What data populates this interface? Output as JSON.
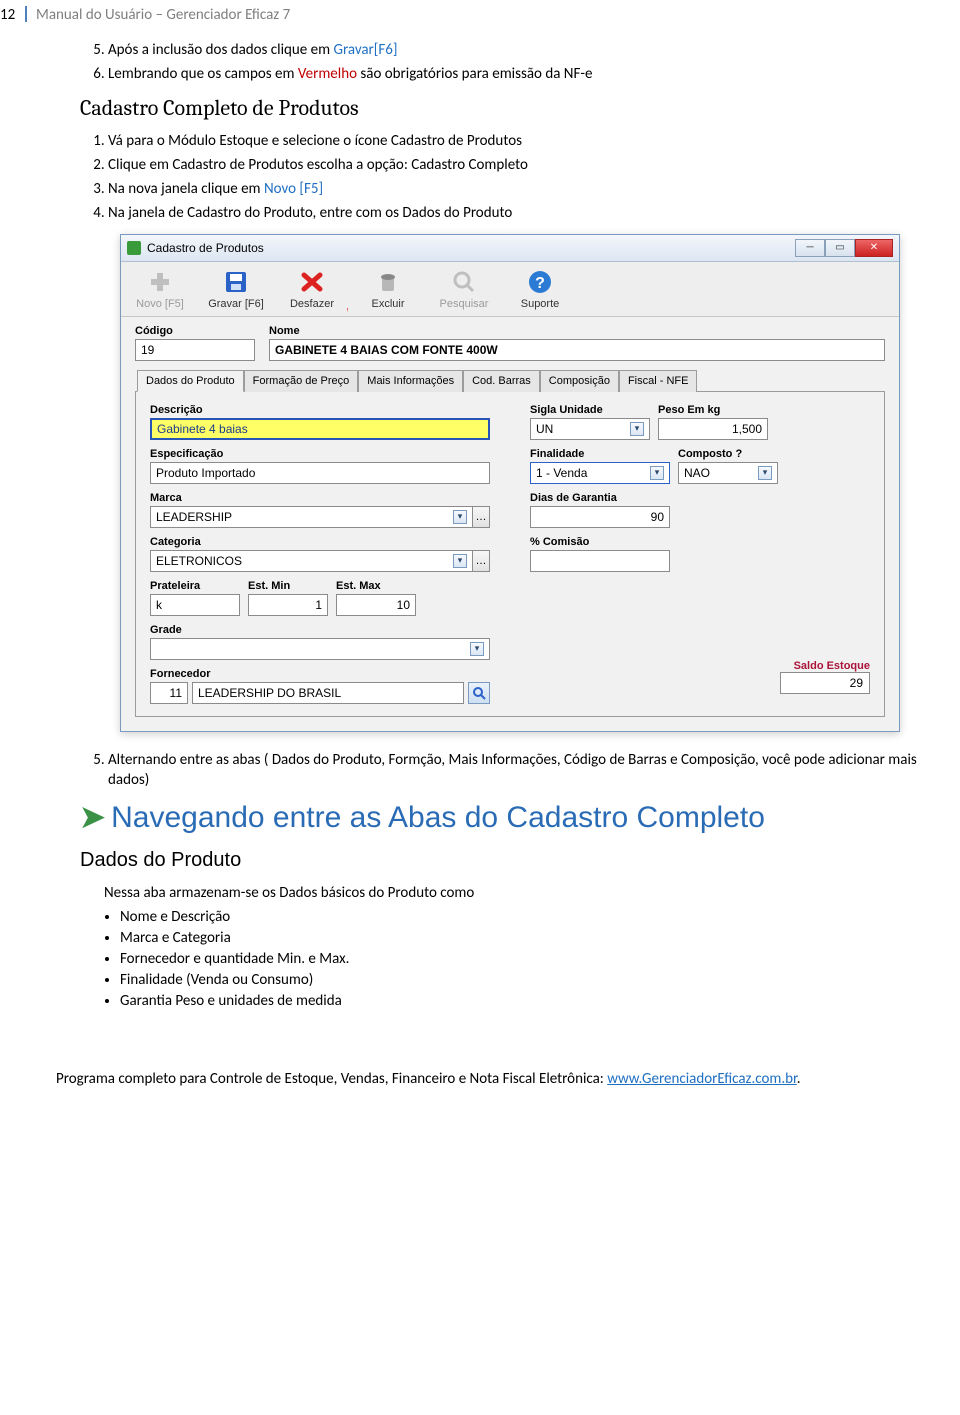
{
  "header": {
    "page_number": "12",
    "title": "Manual do Usuário – Gerenciador Eficaz 7"
  },
  "list_top": {
    "item5_a": "Após a inclusão dos dados clique em ",
    "item5_b": "Gravar[F6]",
    "item6_a": "Lembrando que os campos em ",
    "item6_b": "Vermelho",
    "item6_c": " são obrigatórios para emissão da NF-e"
  },
  "section1_title": "Cadastro Completo de Produtos",
  "list_steps": {
    "s1": "Vá para o Módulo Estoque e selecione o ícone Cadastro de Produtos",
    "s2": "Clique em Cadastro de Produtos escolha a opção: Cadastro Completo",
    "s3_a": "Na nova janela clique em ",
    "s3_b": "Novo [F5]",
    "s4": "Na janela de Cadastro do Produto, entre com os Dados do Produto"
  },
  "window": {
    "title": "Cadastro de Produtos",
    "toolbar": {
      "novo": "Novo [F5]",
      "gravar": "Gravar [F6]",
      "desfazer": "Desfazer",
      "excluir": "Excluir",
      "pesquisar": "Pesquisar",
      "suporte": "Suporte"
    },
    "codigo_label": "Código",
    "codigo_value": "19",
    "nome_label": "Nome",
    "nome_value": "GABINETE 4 BAIAS COM FONTE 400W",
    "tabs": {
      "dados": "Dados do Produto",
      "preco": "Formação de Preço",
      "mais": "Mais Informações",
      "barras": "Cod. Barras",
      "comp": "Composição",
      "fiscal": "Fiscal - NFE"
    },
    "labels": {
      "descricao": "Descrição",
      "especificacao": "Especificação",
      "marca": "Marca",
      "categoria": "Categoria",
      "prateleira": "Prateleira",
      "estmin": "Est. Min",
      "estmax": "Est. Max",
      "grade": "Grade",
      "fornecedor": "Fornecedor",
      "sigla": "Sigla Unidade",
      "peso": "Peso Em kg",
      "finalidade": "Finalidade",
      "composto": "Composto ?",
      "garantia": "Dias de Garantia",
      "comissao": "% Comisão",
      "saldo": "Saldo Estoque"
    },
    "values": {
      "descricao": "Gabinete 4 baias",
      "especificacao": "Produto Importado",
      "marca": "LEADERSHIP",
      "categoria": "ELETRONICOS",
      "prateleira": "k",
      "estmin": "1",
      "estmax": "10",
      "grade": "",
      "fornecedor_code": "11",
      "fornecedor_name": "LEADERSHIP DO BRASIL",
      "sigla": "UN",
      "peso": "1,500",
      "finalidade": "1 - Venda",
      "composto": "NAO",
      "garantia": "90",
      "comissao": "",
      "saldo": "29"
    }
  },
  "step5": "Alternando entre as abas ( Dados do Produto, Formção, Mais Informações, Código de Barras e Composição, você pode adicionar mais dados)",
  "big_heading": "Navegando entre as Abas do Cadastro Completo",
  "sub_heading": "Dados do Produto",
  "sub_text": "Nessa aba armazenam-se os Dados básicos do Produto como",
  "bullets": {
    "b1": "Nome e Descrição",
    "b2": "Marca e Categoria",
    "b3": "Fornecedor e quantidade Min. e Max.",
    "b4": "Finalidade (Venda ou Consumo)",
    "b5": "Garantia Peso e unidades de medida"
  },
  "footer": {
    "text": "Programa completo para Controle de Estoque, Vendas, Financeiro e Nota Fiscal Eletrônica: ",
    "link": "www.GerenciadorEficaz.com.br",
    "dot": "."
  }
}
